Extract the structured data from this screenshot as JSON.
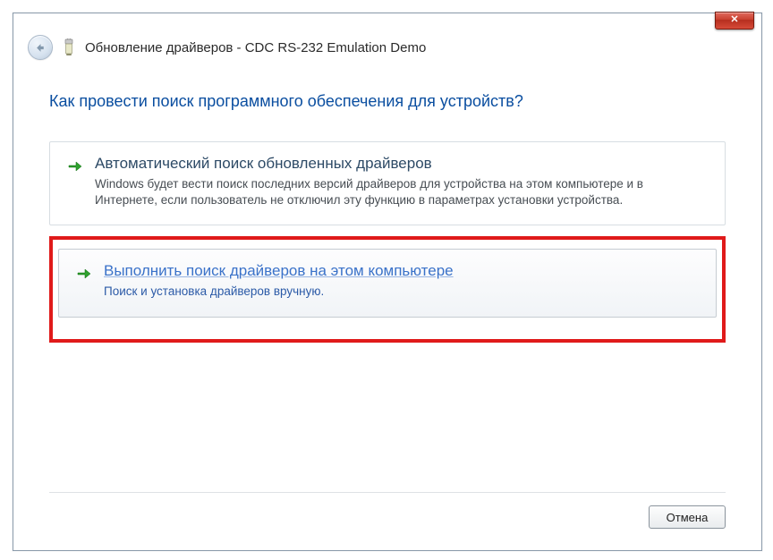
{
  "window": {
    "close_label": "✕",
    "title": "Обновление драйверов - CDC RS-232 Emulation Demo"
  },
  "question": "Как провести поиск программного обеспечения для устройств?",
  "options": [
    {
      "title": "Автоматический поиск обновленных драйверов",
      "desc": "Windows будет вести поиск последних версий драйверов для устройства на этом компьютере и в Интернете, если пользователь не отключил эту функцию в параметрах установки устройства."
    },
    {
      "title": "Выполнить поиск драйверов на этом компьютере",
      "desc": "Поиск и установка драйверов вручную."
    }
  ],
  "footer": {
    "cancel_label": "Отмена"
  }
}
